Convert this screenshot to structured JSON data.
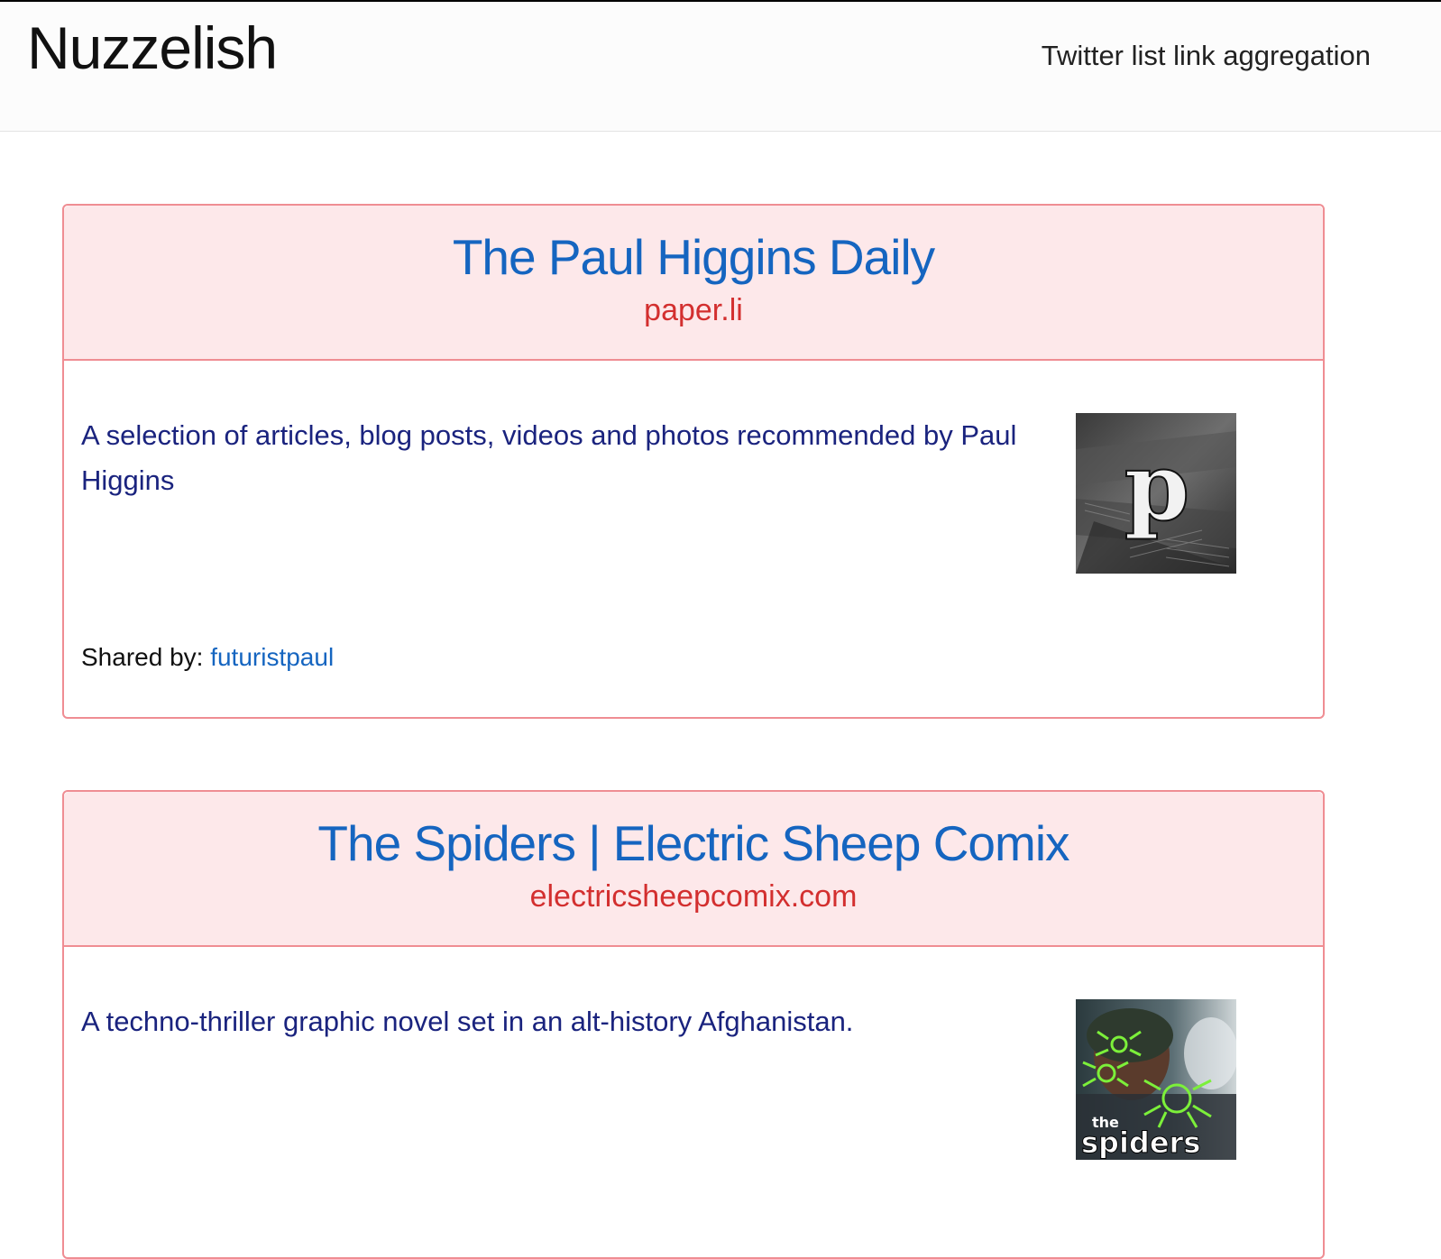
{
  "header": {
    "brand": "Nuzzelish",
    "tagline": "Twitter list link aggregation"
  },
  "cards": [
    {
      "title": "The Paul Higgins Daily",
      "domain": "paper.li",
      "description": "A selection of articles, blog posts, videos and photos recommended by Paul Higgins",
      "thumb_icon": "paper-li-logo",
      "thumb_letter": "p",
      "shared_label": "Shared by:",
      "shared_user": "futuristpaul"
    },
    {
      "title": "The Spiders | Electric Sheep Comix",
      "domain": "electricsheepcomix.com",
      "description": "A techno-thriller graphic novel set in an alt-history Afghanistan.",
      "thumb_icon": "the-spiders-cover",
      "thumb_small": "the",
      "thumb_big": "spiders"
    }
  ],
  "colors": {
    "link": "#1565c0",
    "domain": "#d32f2f",
    "description": "#1a237e",
    "card_border": "#ef8d93",
    "card_header_bg": "#fde8ea"
  }
}
